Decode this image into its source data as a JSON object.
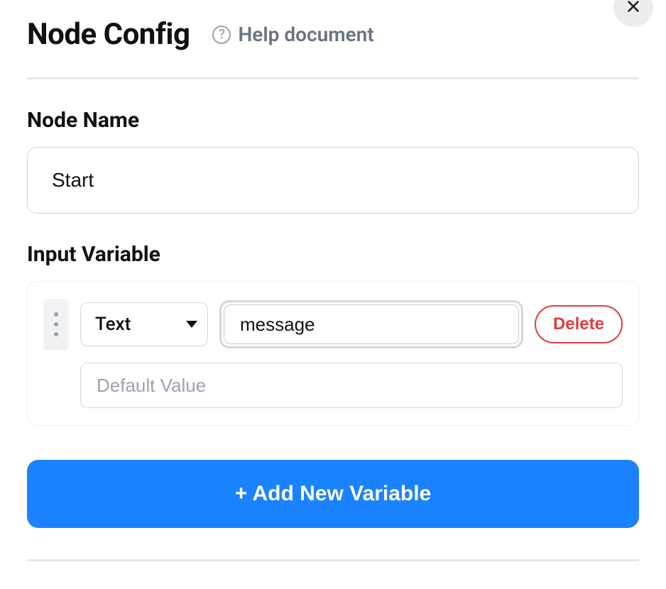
{
  "header": {
    "title": "Node Config",
    "help_label": "Help document"
  },
  "sections": {
    "node_name_label": "Node Name",
    "input_variable_label": "Input Variable"
  },
  "node_name_value": "Start",
  "variable": {
    "type_selected": "Text",
    "name_value": "message",
    "default_placeholder": "Default Value",
    "delete_label": "Delete"
  },
  "add_button_label": "+ Add New Variable"
}
